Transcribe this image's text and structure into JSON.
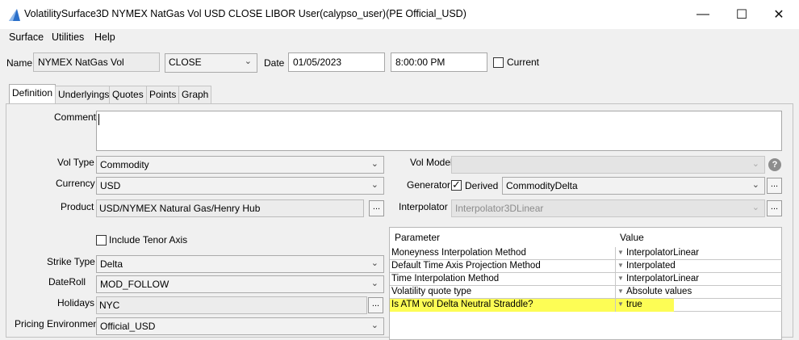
{
  "window": {
    "title": "VolatilitySurface3D NYMEX NatGas Vol USD CLOSE LIBOR User(calypso_user)(PE Official_USD)",
    "minimize": "—",
    "maximize": "☐",
    "close": "✕"
  },
  "menu": [
    "Surface",
    "Utilities",
    "Help"
  ],
  "header": {
    "name_label": "Name",
    "name_value": "NYMEX NatGas Vol",
    "close_value": "CLOSE",
    "date_label": "Date",
    "date_value": "01/05/2023",
    "time_value": "8:00:00 PM",
    "current_label": "Current"
  },
  "tabs": [
    "Definition",
    "Underlyings",
    "Quotes",
    "Points",
    "Graph"
  ],
  "definition": {
    "comment_label": "Comment",
    "comment_value": "",
    "vol_type_label": "Vol Type",
    "vol_type_value": "Commodity",
    "currency_label": "Currency",
    "currency_value": "USD",
    "product_label": "Product",
    "product_value": "USD/NYMEX Natural Gas/Henry Hub",
    "include_tenor_label": "Include Tenor Axis",
    "strike_type_label": "Strike Type",
    "strike_type_value": "Delta",
    "dateroll_label": "DateRoll",
    "dateroll_value": "MOD_FOLLOW",
    "holidays_label": "Holidays",
    "holidays_value": "NYC",
    "pricing_env_label": "Pricing Environment",
    "pricing_env_value": "Official_USD",
    "vol_model_label": "Vol Model",
    "vol_model_value": "",
    "generator_label": "Generator",
    "derived_label": "Derived",
    "generator_value": "CommodityDelta",
    "interpolator_label": "Interpolator",
    "interpolator_value": "Interpolator3DLinear",
    "dots": "...",
    "help": "?"
  },
  "param_table": {
    "headers": [
      "Parameter",
      "Value"
    ],
    "rows": [
      {
        "param": "Moneyness Interpolation Method",
        "value": "InterpolatorLinear"
      },
      {
        "param": "Default Time Axis Projection Method",
        "value": "Interpolated"
      },
      {
        "param": "Time Interpolation Method",
        "value": "InterpolatorLinear"
      },
      {
        "param": "Volatility quote type",
        "value": "Absolute values"
      },
      {
        "param": "Is ATM vol Delta Neutral Straddle?",
        "value": "true"
      }
    ]
  },
  "colors": {
    "highlight": "#fdfd55",
    "app_icon_blue": "#2a6fc9"
  }
}
